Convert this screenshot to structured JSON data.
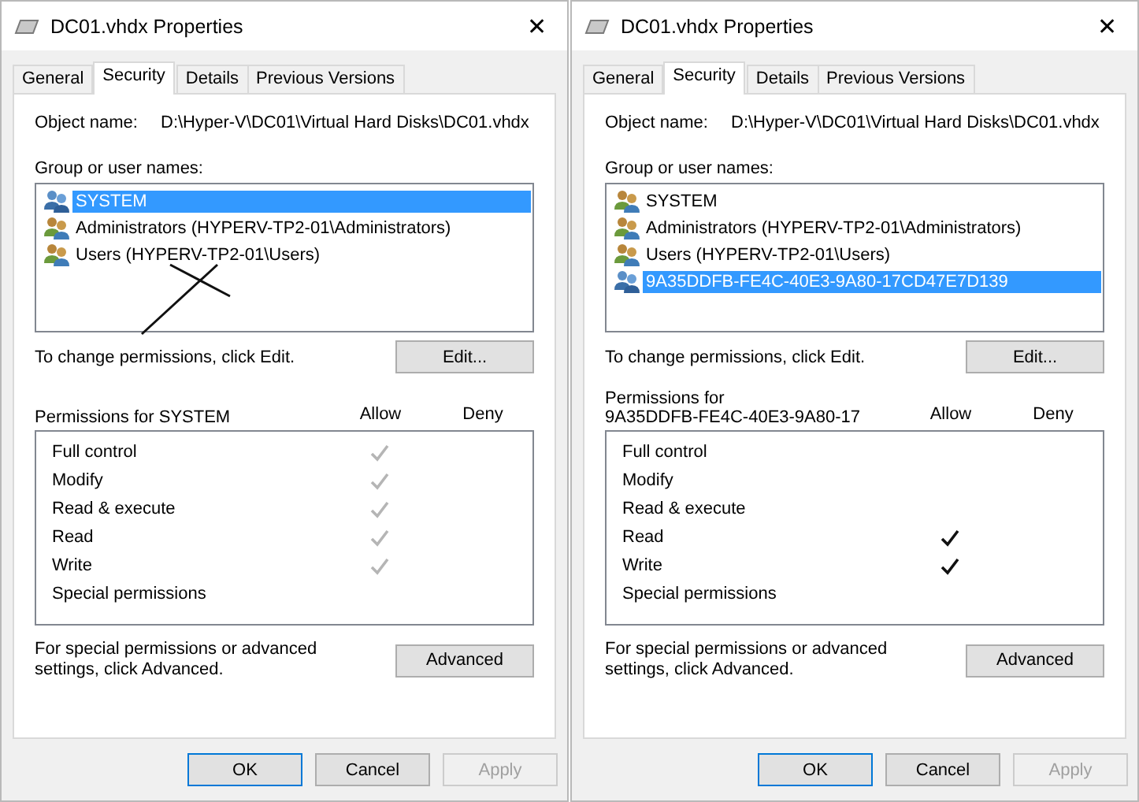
{
  "dialogs": [
    {
      "window": {
        "title": "DC01.vhdx Properties",
        "close": "✕"
      },
      "tabs": [
        {
          "label": "General",
          "selected": false
        },
        {
          "label": "Security",
          "selected": true
        },
        {
          "label": "Details",
          "selected": false
        },
        {
          "label": "Previous Versions",
          "selected": false
        }
      ],
      "object_name": {
        "label": "Object name:",
        "value": "D:\\Hyper-V\\DC01\\Virtual Hard Disks\\DC01.vhdx"
      },
      "group_label": "Group or user names:",
      "groups": [
        {
          "name": "SYSTEM",
          "selected": true
        },
        {
          "name": "Administrators (HYPERV-TP2-01\\Administrators)",
          "selected": false
        },
        {
          "name": "Users (HYPERV-TP2-01\\Users)",
          "selected": false
        }
      ],
      "cross_mark": true,
      "edit_hint": "To change permissions, click Edit.",
      "edit_button": "Edit...",
      "permissions_label_lines": [
        "Permissions for SYSTEM"
      ],
      "allow_header": "Allow",
      "deny_header": "Deny",
      "checks_greyed": true,
      "permissions": [
        {
          "name": "Full control",
          "allow": true
        },
        {
          "name": "Modify",
          "allow": true
        },
        {
          "name": "Read & execute",
          "allow": true
        },
        {
          "name": "Read",
          "allow": true
        },
        {
          "name": "Write",
          "allow": true
        },
        {
          "name": "Special permissions",
          "allow": false
        }
      ],
      "advanced_hint": "For special permissions or advanced settings, click Advanced.",
      "advanced_button": "Advanced",
      "buttons": [
        {
          "label": "OK",
          "kind": "default"
        },
        {
          "label": "Cancel",
          "kind": "normal"
        },
        {
          "label": "Apply",
          "kind": "disabled"
        }
      ]
    },
    {
      "window": {
        "title": "DC01.vhdx Properties",
        "close": "✕"
      },
      "tabs": [
        {
          "label": "General",
          "selected": false
        },
        {
          "label": "Security",
          "selected": true
        },
        {
          "label": "Details",
          "selected": false
        },
        {
          "label": "Previous Versions",
          "selected": false
        }
      ],
      "object_name": {
        "label": "Object name:",
        "value": "D:\\Hyper-V\\DC01\\Virtual Hard Disks\\DC01.vhdx"
      },
      "group_label": "Group or user names:",
      "groups": [
        {
          "name": "SYSTEM",
          "selected": false
        },
        {
          "name": "Administrators (HYPERV-TP2-01\\Administrators)",
          "selected": false
        },
        {
          "name": "Users (HYPERV-TP2-01\\Users)",
          "selected": false
        },
        {
          "name": "9A35DDFB-FE4C-40E3-9A80-17CD47E7D139",
          "selected": true
        }
      ],
      "edit_hint": "To change permissions, click Edit.",
      "edit_button": "Edit...",
      "permissions_label_lines": [
        "Permissions for",
        "9A35DDFB-FE4C-40E3-9A80-17"
      ],
      "allow_header": "Allow",
      "deny_header": "Deny",
      "checks_greyed": false,
      "permissions": [
        {
          "name": "Full control",
          "allow": false
        },
        {
          "name": "Modify",
          "allow": false
        },
        {
          "name": "Read & execute",
          "allow": false
        },
        {
          "name": "Read",
          "allow": true
        },
        {
          "name": "Write",
          "allow": true
        },
        {
          "name": "Special permissions",
          "allow": false
        }
      ],
      "advanced_hint": "For special permissions or advanced settings, click Advanced.",
      "advanced_button": "Advanced",
      "buttons": [
        {
          "label": "OK",
          "kind": "default"
        },
        {
          "label": "Cancel",
          "kind": "normal"
        },
        {
          "label": "Apply",
          "kind": "disabled"
        }
      ]
    }
  ]
}
